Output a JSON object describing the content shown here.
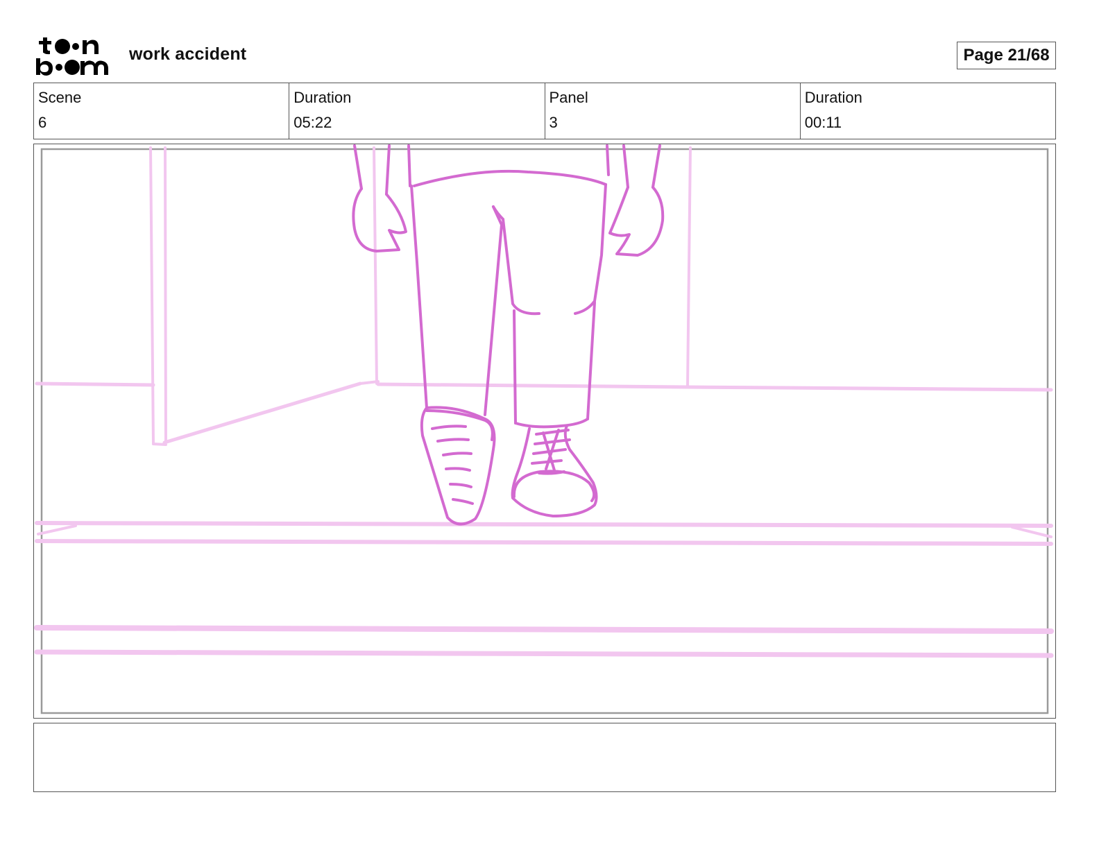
{
  "header": {
    "logo_text_top": "toon",
    "logo_text_bottom": "boom",
    "title": "work accident",
    "page_label": "Page 21/68"
  },
  "info": {
    "scene_label": "Scene",
    "scene_value": "6",
    "scene_duration_label": "Duration",
    "scene_duration_value": "05:22",
    "panel_label": "Panel",
    "panel_value": "3",
    "panel_duration_label": "Duration",
    "panel_duration_value": "00:11"
  },
  "colors": {
    "sketch": "#d36ad0",
    "sketch_light": "#f2c6ef",
    "border": "#555555"
  },
  "notes": {
    "text": ""
  }
}
